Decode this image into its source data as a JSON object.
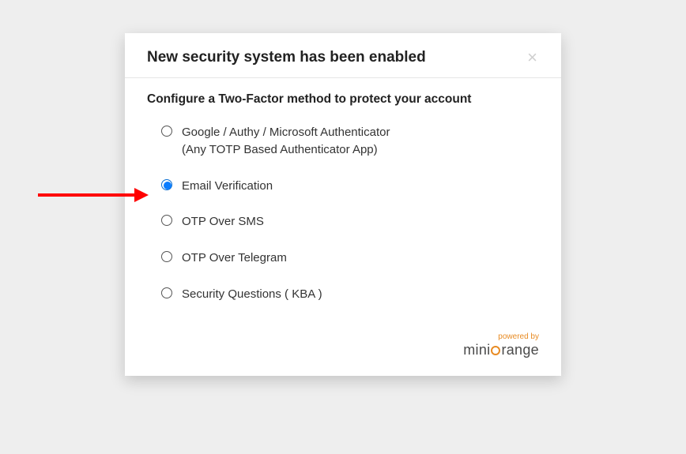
{
  "modal": {
    "title": "New security system has been enabled",
    "subtitle": "Configure a Two-Factor method to protect your account",
    "options": [
      {
        "label": "Google / Authy / Microsoft Authenticator",
        "sub": "(Any TOTP Based Authenticator App)",
        "selected": false
      },
      {
        "label": "Email Verification",
        "sub": "",
        "selected": true
      },
      {
        "label": "OTP Over SMS",
        "sub": "",
        "selected": false
      },
      {
        "label": "OTP Over Telegram",
        "sub": "",
        "selected": false
      },
      {
        "label": "Security Questions ( KBA )",
        "sub": "",
        "selected": false
      }
    ]
  },
  "footer": {
    "powered_by": "powered by",
    "brand_prefix": "mini",
    "brand_suffix": "range"
  }
}
